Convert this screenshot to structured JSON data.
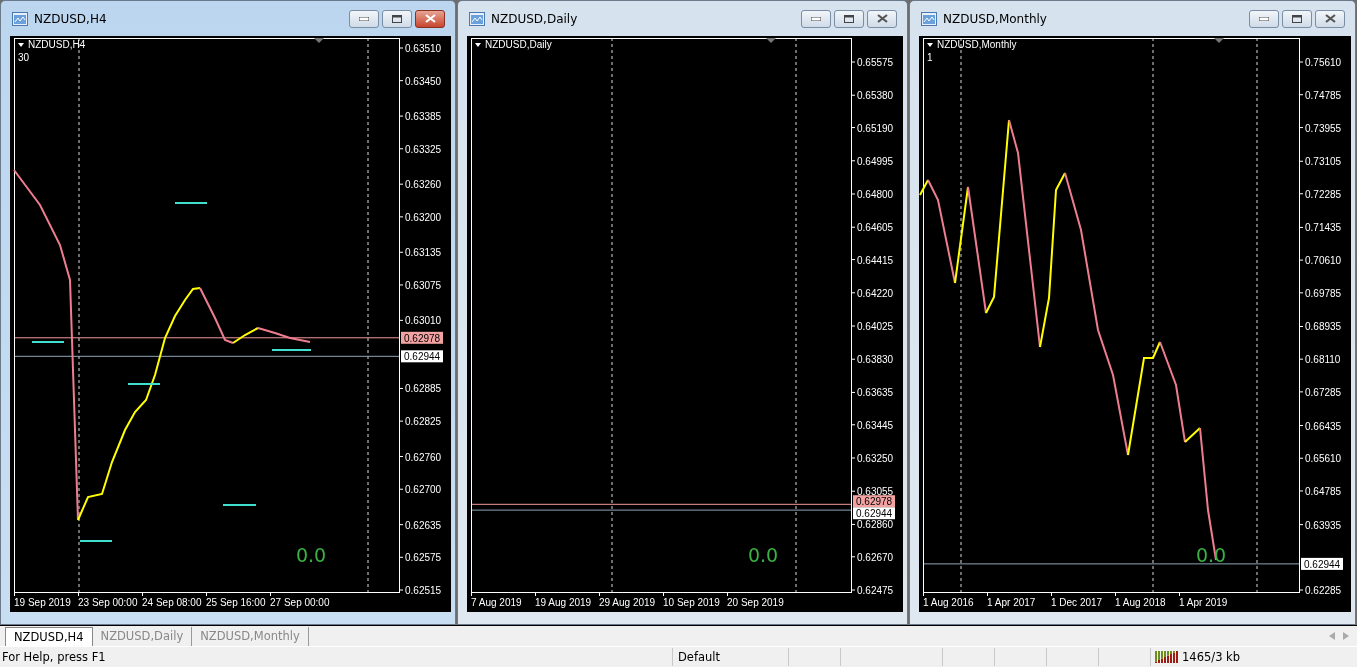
{
  "windows": [
    {
      "title": "NZDUSD,H4",
      "active": true,
      "chart": {
        "symbol_label": "NZDUSD,H4",
        "indicator_value": "30",
        "readout": "0.0",
        "price_labels": [
          {
            "text": "0.63510",
            "kind": "tick"
          },
          {
            "text": "0.63450",
            "kind": "tick"
          },
          {
            "text": "0.63385",
            "kind": "tick"
          },
          {
            "text": "0.63325",
            "kind": "tick"
          },
          {
            "text": "0.63260",
            "kind": "tick"
          },
          {
            "text": "0.63200",
            "kind": "tick"
          },
          {
            "text": "0.63135",
            "kind": "tick"
          },
          {
            "text": "0.63075",
            "kind": "tick"
          },
          {
            "text": "0.63010",
            "kind": "tick"
          },
          {
            "text": "0.62978",
            "kind": "ask"
          },
          {
            "text": "0.62944",
            "kind": "bid"
          },
          {
            "text": "0.62885",
            "kind": "tick"
          },
          {
            "text": "0.62825",
            "kind": "tick"
          },
          {
            "text": "0.62760",
            "kind": "tick"
          },
          {
            "text": "0.62700",
            "kind": "tick"
          },
          {
            "text": "0.62635",
            "kind": "tick"
          },
          {
            "text": "0.62575",
            "kind": "tick"
          },
          {
            "text": "0.62515",
            "kind": "tick"
          }
        ],
        "time_labels": [
          "19 Sep 2019",
          "23 Sep 00:00",
          "24 Sep 08:00",
          "25 Sep 16:00",
          "27 Sep 00:00"
        ]
      }
    },
    {
      "title": "NZDUSD,Daily",
      "active": false,
      "chart": {
        "symbol_label": "NZDUSD,Daily",
        "readout": "0.0",
        "price_labels": [
          {
            "text": "0.65575",
            "kind": "tick"
          },
          {
            "text": "0.65380",
            "kind": "tick"
          },
          {
            "text": "0.65190",
            "kind": "tick"
          },
          {
            "text": "0.64995",
            "kind": "tick"
          },
          {
            "text": "0.64800",
            "kind": "tick"
          },
          {
            "text": "0.64605",
            "kind": "tick"
          },
          {
            "text": "0.64415",
            "kind": "tick"
          },
          {
            "text": "0.64220",
            "kind": "tick"
          },
          {
            "text": "0.64025",
            "kind": "tick"
          },
          {
            "text": "0.63830",
            "kind": "tick"
          },
          {
            "text": "0.63635",
            "kind": "tick"
          },
          {
            "text": "0.63445",
            "kind": "tick"
          },
          {
            "text": "0.63250",
            "kind": "tick"
          },
          {
            "text": "0.63055",
            "kind": "tick"
          },
          {
            "text": "0.62978",
            "kind": "ask"
          },
          {
            "text": "0.62944",
            "kind": "bid"
          },
          {
            "text": "0.62860",
            "kind": "tick"
          },
          {
            "text": "0.62670",
            "kind": "tick"
          },
          {
            "text": "0.62475",
            "kind": "tick"
          }
        ],
        "time_labels": [
          "7 Aug 2019",
          "19 Aug 2019",
          "29 Aug 2019",
          "10 Sep 2019",
          "20 Sep 2019"
        ]
      }
    },
    {
      "title": "NZDUSD,Monthly",
      "active": false,
      "chart": {
        "symbol_label": "NZDUSD,Monthly",
        "indicator_value": "1",
        "readout": "0.0",
        "price_labels": [
          {
            "text": "0.75610",
            "kind": "tick"
          },
          {
            "text": "0.74785",
            "kind": "tick"
          },
          {
            "text": "0.73955",
            "kind": "tick"
          },
          {
            "text": "0.73105",
            "kind": "tick"
          },
          {
            "text": "0.72285",
            "kind": "tick"
          },
          {
            "text": "0.71435",
            "kind": "tick"
          },
          {
            "text": "0.70610",
            "kind": "tick"
          },
          {
            "text": "0.69785",
            "kind": "tick"
          },
          {
            "text": "0.68935",
            "kind": "tick"
          },
          {
            "text": "0.68110",
            "kind": "tick"
          },
          {
            "text": "0.67285",
            "kind": "tick"
          },
          {
            "text": "0.66435",
            "kind": "tick"
          },
          {
            "text": "0.65610",
            "kind": "tick"
          },
          {
            "text": "0.64785",
            "kind": "tick"
          },
          {
            "text": "0.63935",
            "kind": "tick"
          },
          {
            "text": "0.62944",
            "kind": "bid"
          },
          {
            "text": "0.62285",
            "kind": "tick"
          }
        ],
        "time_labels": [
          "1 Aug 2016",
          "1 Apr 2017",
          "1 Dec 2017",
          "1 Aug 2018",
          "1 Apr 2019"
        ]
      }
    }
  ],
  "tabs": [
    {
      "label": "NZDUSD,H4",
      "selected": true
    },
    {
      "label": "NZDUSD,Daily",
      "selected": false
    },
    {
      "label": "NZDUSD,Monthly",
      "selected": false
    }
  ],
  "status_bar": {
    "help": "For Help, press F1",
    "profile": "Default",
    "traffic": "1465/3 kb"
  }
}
